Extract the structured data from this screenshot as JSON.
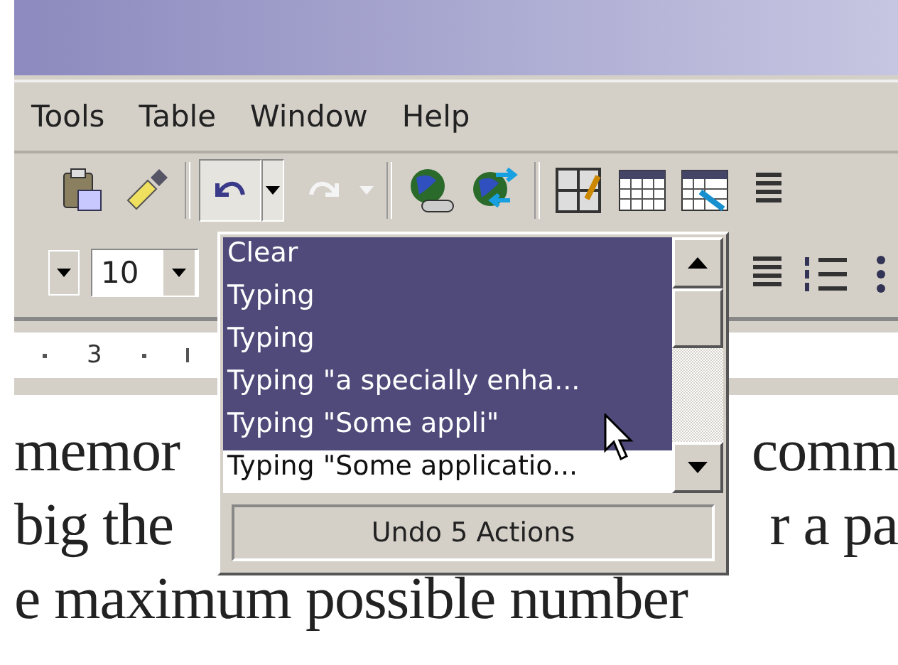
{
  "menu": [
    {
      "label": "Tools"
    },
    {
      "label": "Table"
    },
    {
      "label": "Window"
    },
    {
      "label": "Help"
    }
  ],
  "toolbar": {
    "undo_open": true,
    "redo_enabled": false
  },
  "formatting": {
    "font_size": "10"
  },
  "ruler": {
    "labels": [
      "3"
    ]
  },
  "undo_list": {
    "items": [
      {
        "label": "Clear",
        "selected": true
      },
      {
        "label": "Typing",
        "selected": true
      },
      {
        "label": "Typing",
        "selected": true
      },
      {
        "label": "Typing \"a specially enha...",
        "selected": true
      },
      {
        "label": "Typing \"Some appli\"",
        "selected": true
      },
      {
        "label": "Typing \"Some applicatio...",
        "selected": false
      }
    ],
    "button": "Undo 5 Actions"
  },
  "document": {
    "lines": [
      {
        "left": "memor",
        "right": "comm"
      },
      {
        "left": "big the",
        "right": "r a pa"
      },
      {
        "left": "e maximum possible number"
      }
    ]
  }
}
